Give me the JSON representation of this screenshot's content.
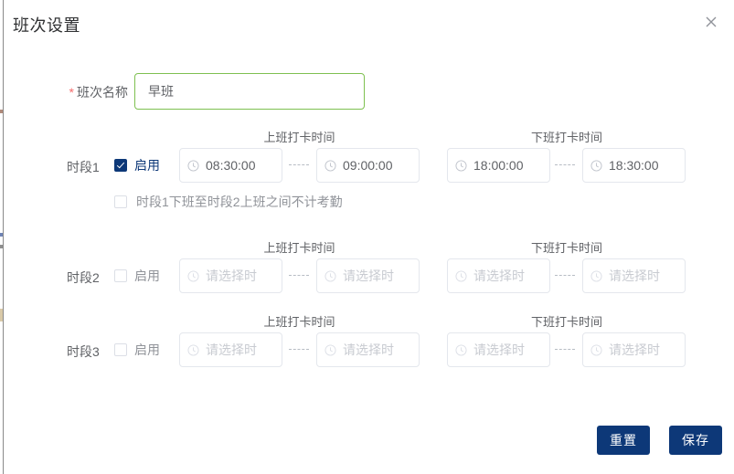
{
  "dialog": {
    "title": "班次设置",
    "close_icon": "close-icon"
  },
  "form": {
    "name_field": {
      "required_mark": "*",
      "label": "班次名称",
      "value": "早班"
    },
    "column_headers": {
      "clock_in": "上班打卡时间",
      "clock_out": "下班打卡时间"
    },
    "separator": "-----",
    "enable_label": "启用",
    "time_placeholder": "请选择时",
    "no_attendance_note": "时段1下班至时段2上班之间不计考勤",
    "periods": [
      {
        "label": "时段1",
        "enabled": true,
        "clock_in_start": "08:30:00",
        "clock_in_end": "09:00:00",
        "clock_out_start": "18:00:00",
        "clock_out_end": "18:30:00"
      },
      {
        "label": "时段2",
        "enabled": false,
        "clock_in_start": "请选择时",
        "clock_in_end": "请选择时",
        "clock_out_start": "请选择时",
        "clock_out_end": "请选择时"
      },
      {
        "label": "时段3",
        "enabled": false,
        "clock_in_start": "请选择时",
        "clock_in_end": "请选择时",
        "clock_out_start": "请选择时",
        "clock_out_end": "请选择时"
      }
    ]
  },
  "footer": {
    "reset_label": "重置",
    "save_label": "保存"
  },
  "colors": {
    "primary": "#0d3878",
    "required": "#f56c6c",
    "valid_border": "#7ec050",
    "text": "#606266",
    "placeholder": "#c8cbd1"
  }
}
